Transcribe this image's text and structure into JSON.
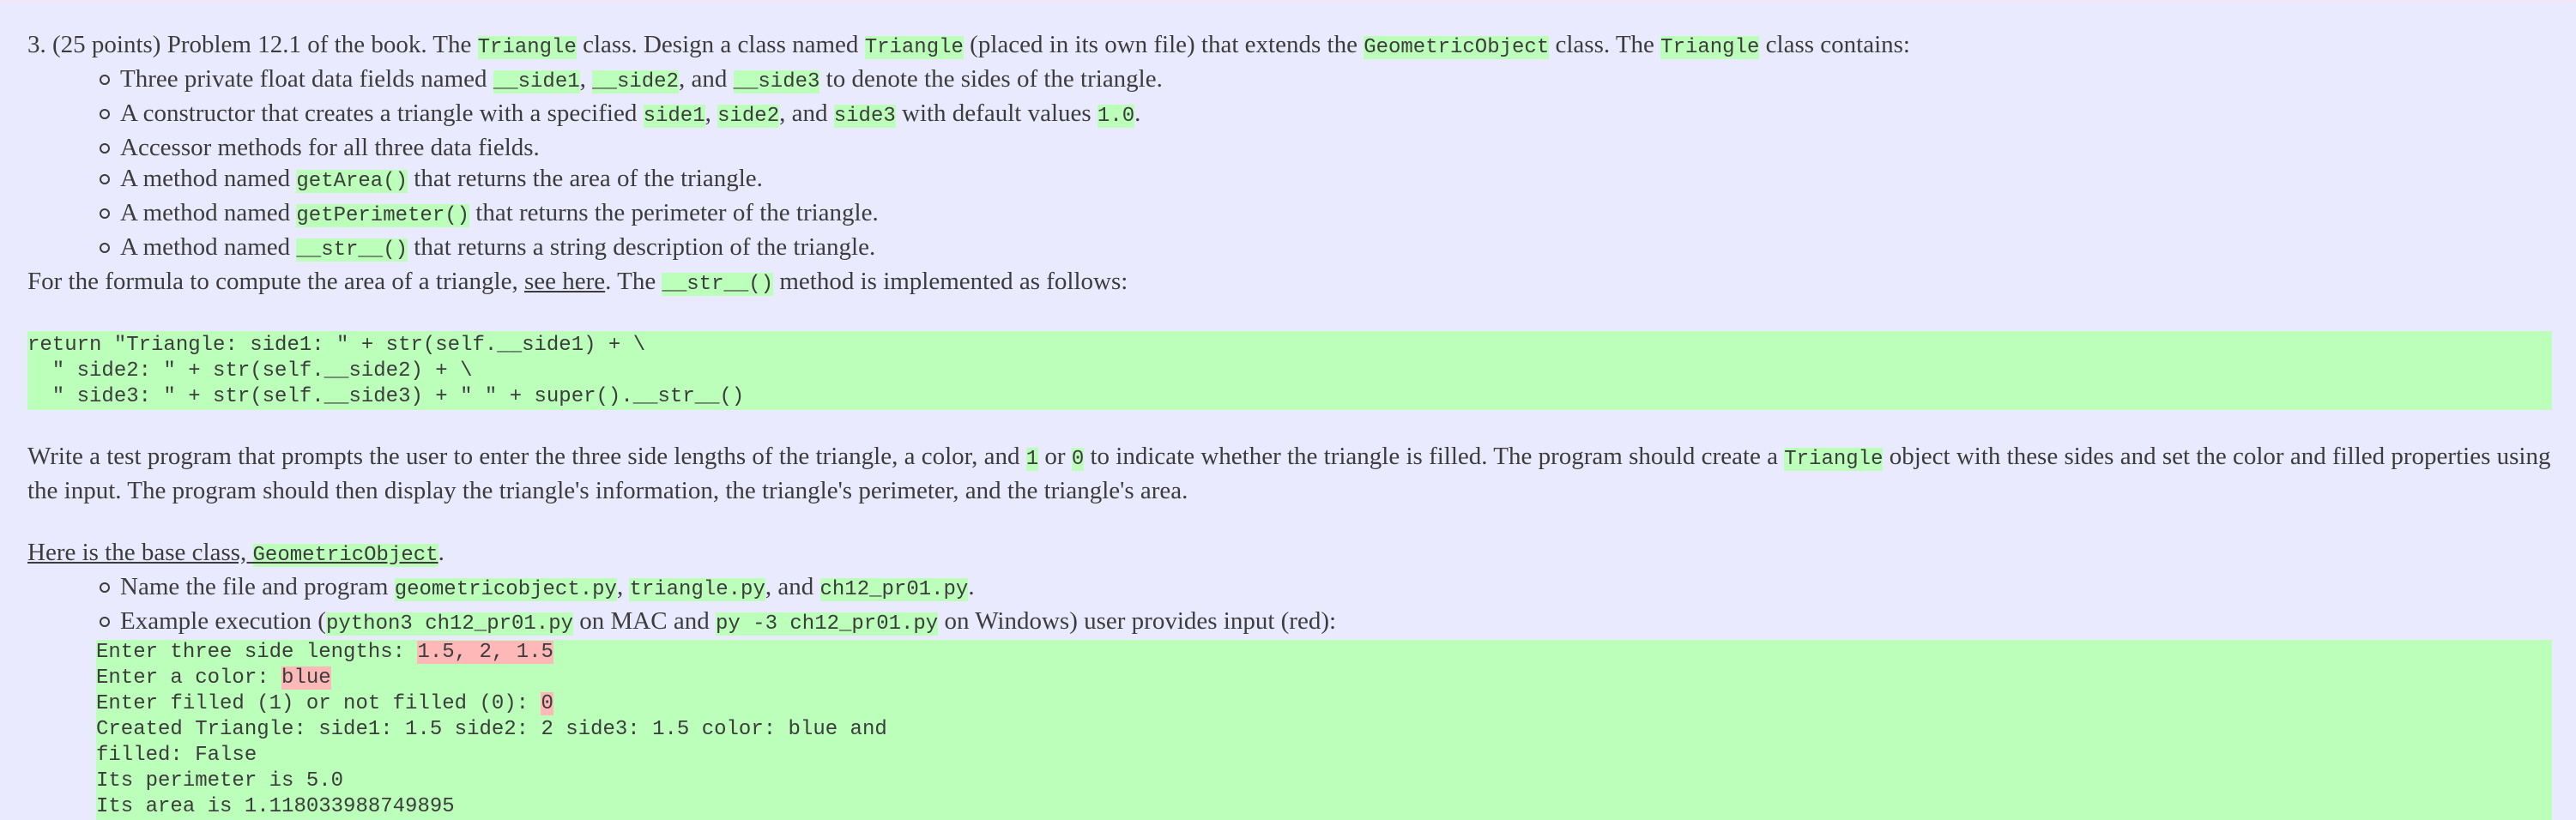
{
  "problem": {
    "number": "3.",
    "intro_parts": [
      "(25 points) Problem 12.1 of the book. The ",
      "Triangle",
      " class. Design a class named ",
      "Triangle",
      " (placed in its own file) that extends the ",
      "GeometricObject",
      " class. The ",
      "Triangle",
      " class contains:"
    ],
    "contains": [
      {
        "parts": [
          "Three private float data fields named ",
          "__side1",
          ", ",
          "__side2",
          ", and ",
          "__side3",
          " to denote the sides of the triangle."
        ]
      },
      {
        "parts": [
          "A constructor that creates a triangle with a specified ",
          "side1",
          ", ",
          "side2",
          ", and ",
          "side3",
          " with default values ",
          "1.0",
          "."
        ]
      },
      {
        "parts": [
          "Accessor methods for all three data fields."
        ]
      },
      {
        "parts": [
          "A method named ",
          "getArea()",
          " that returns the area of the triangle."
        ]
      },
      {
        "parts": [
          "A method named ",
          "getPerimeter()",
          " that returns the perimeter of the triangle."
        ]
      },
      {
        "parts": [
          "A method named ",
          "__str__()",
          " that returns a string description of the triangle."
        ]
      }
    ],
    "formula_line": {
      "before": "For the formula to compute the area of a triangle, ",
      "link": "see here",
      "middle": ". The ",
      "code": "__str__()",
      "after": " method is implemented as follows:"
    },
    "str_code": [
      "return \"Triangle: side1: \" + str(self.__side1) + \\",
      "  \" side2: \" + str(self.__side2) + \\",
      "  \" side3: \" + str(self.__side3) + \" \" + super().__str__()"
    ],
    "test_program": {
      "before": "Write a test program that prompts the user to enter the three side lengths of the triangle, a color, and ",
      "one": "1",
      "or": " or ",
      "zero": "0",
      "middle": " to indicate whether the triangle is filled. The program should create a ",
      "cls": "Triangle",
      "after": " object with these sides and set the color and filled properties using the input. The program should then display the triangle's information, the triangle's perimeter, and the triangle's area."
    },
    "base_class": {
      "link": "Here is the base class, ",
      "code": "GeometricObject",
      "after": "."
    },
    "notes": {
      "files": {
        "before": "Name the file and program ",
        "f1": "geometricobject.py",
        "sep1": ", ",
        "f2": "triangle.py",
        "sep2": ", and ",
        "f3": "ch12_pr01.py",
        "after": "."
      },
      "execution": {
        "before": "Example execution (",
        "mac_cmd": "python3 ch12_pr01.py",
        "mid": " on MAC and ",
        "win_cmd": "py -3 ch12_pr01.py",
        "after": " on Windows) user provides input (red):"
      }
    },
    "example_run": {
      "prompt1": "Enter three side lengths: ",
      "input1": "1.5, 2, 1.5",
      "prompt2": "Enter a color: ",
      "input2": "blue",
      "prompt3": "Enter filled (1) or not filled (0): ",
      "input3": "0",
      "output": [
        "Created Triangle: side1: 1.5 side2: 2 side3: 1.5 color: blue and",
        "filled: False",
        "Its perimeter is 5.0",
        "Its area is 1.118033988749895"
      ]
    }
  },
  "colors": {
    "background": "#eaeaff",
    "code_highlight": "#bbffbb",
    "user_input_highlight": "#ffb8b8",
    "text": "#3c3c3c"
  }
}
